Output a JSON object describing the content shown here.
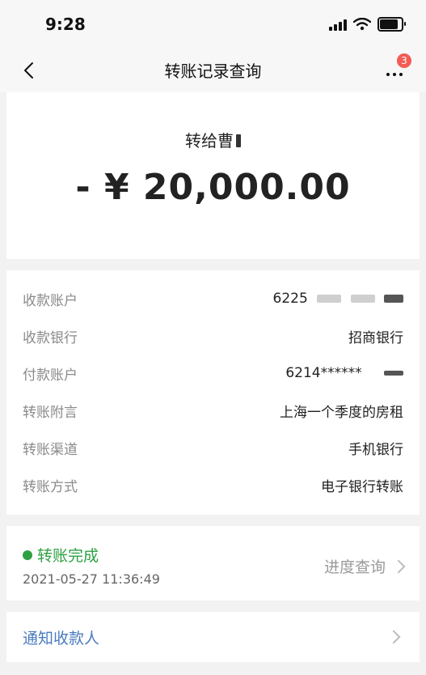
{
  "status_bar": {
    "time": "9:28"
  },
  "nav": {
    "title": "转账记录查询",
    "badge_count": "3"
  },
  "summary": {
    "recipient": "转给曹",
    "amount": "- ¥ 20,000.00"
  },
  "details": [
    {
      "label": "收款账户",
      "value": "6225"
    },
    {
      "label": "收款银行",
      "value": "招商银行"
    },
    {
      "label": "付款账户",
      "value": "6214******"
    },
    {
      "label": "转账附言",
      "value": "上海一个季度的房租"
    },
    {
      "label": "转账渠道",
      "value": "手机银行"
    },
    {
      "label": "转账方式",
      "value": "电子银行转账"
    }
  ],
  "transfer_status": {
    "label": "转账完成",
    "datetime": "2021-05-27 11:36:49",
    "progress_link": "进度查询",
    "status_color": "#2ea043"
  },
  "notify": {
    "label": "通知收款人"
  },
  "icons": [
    "back-icon",
    "more-icon",
    "signal-icon",
    "wifi-icon",
    "battery-icon",
    "chevron-right-icon"
  ]
}
